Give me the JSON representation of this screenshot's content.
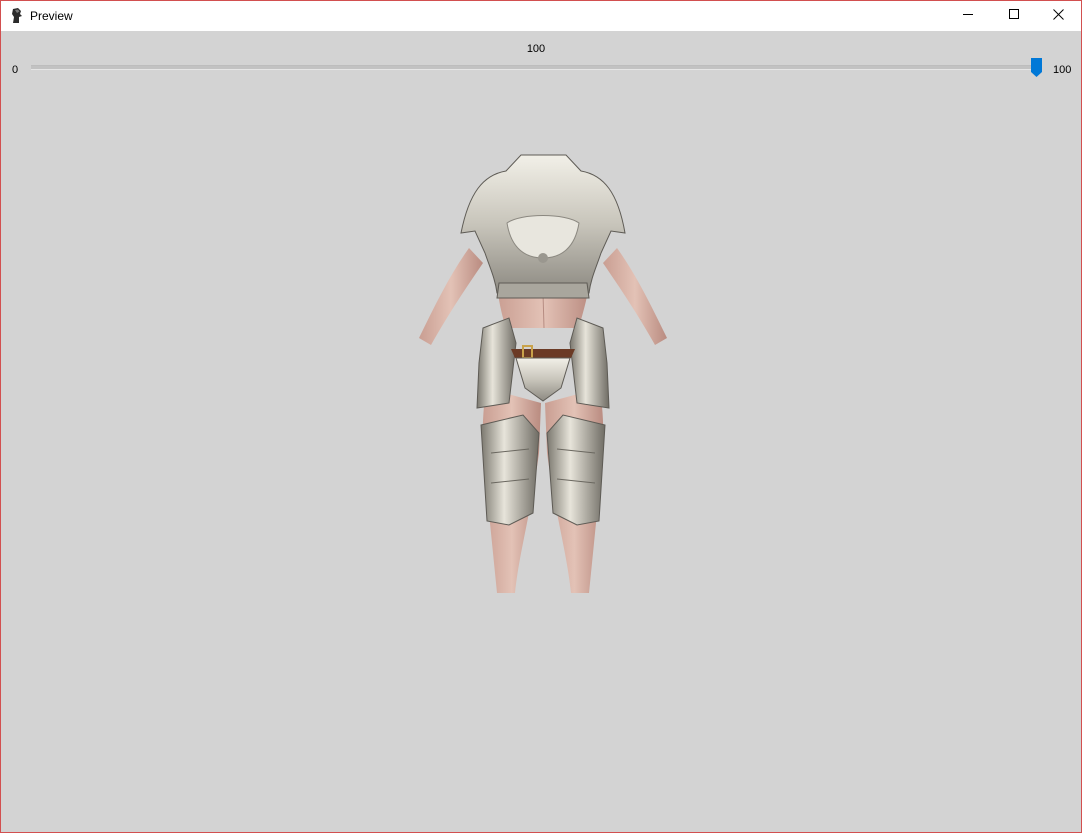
{
  "window": {
    "title": "Preview",
    "app_icon": "app-icon",
    "border_color": "#d24f4f"
  },
  "caption_buttons": {
    "minimize_icon": "minimize-icon",
    "maximize_icon": "maximize-icon",
    "close_icon": "close-icon"
  },
  "slider": {
    "value_label": "100",
    "min_label": "0",
    "max_label": "100",
    "value": 100,
    "min": 0,
    "max": 100,
    "accent": "#0078d7"
  },
  "viewport": {
    "background": "#d3d3d3",
    "content": "armor-model-preview"
  }
}
